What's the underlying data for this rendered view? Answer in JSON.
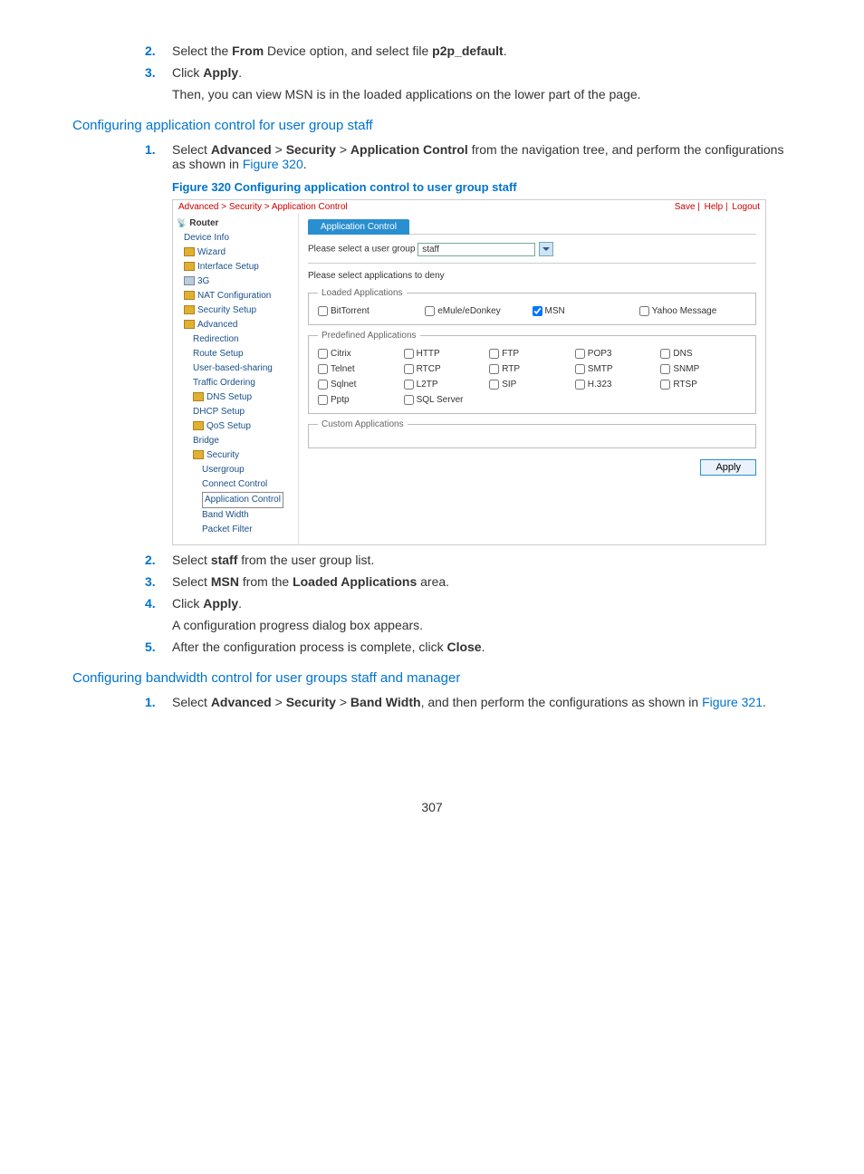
{
  "steps_top": [
    {
      "n": "2.",
      "html_parts": [
        "Select the ",
        {
          "b": "From"
        },
        " Device option, and select file ",
        {
          "b": "p2p_default"
        },
        "."
      ]
    },
    {
      "n": "3.",
      "html_parts": [
        "Click ",
        {
          "b": "Apply"
        },
        "."
      ]
    }
  ],
  "after_apply": "Then, you can view MSN is in the loaded applications on the lower part of the page.",
  "section1": "Configuring application control for user group staff",
  "s1_step1": {
    "n": "1.",
    "parts": [
      "Select ",
      {
        "b": "Advanced"
      },
      " > ",
      {
        "b": "Security"
      },
      " > ",
      {
        "b": "Application Control"
      },
      " from the navigation tree, and perform the configurations as shown in ",
      {
        "link": "Figure 320"
      },
      "."
    ]
  },
  "fig320": "Figure 320 Configuring application control to user group staff",
  "screenshot": {
    "breadcrumb": "Advanced > Security > Application Control",
    "top_links": [
      "Save",
      "Help",
      "Logout"
    ],
    "nav_root": "Router",
    "nav": [
      {
        "lv": 1,
        "label": "Device Info"
      },
      {
        "lv": 1,
        "label": "Wizard",
        "icon": true
      },
      {
        "lv": 1,
        "label": "Interface Setup",
        "icon": true
      },
      {
        "lv": 1,
        "label": "3G",
        "icon": true,
        "gray": true
      },
      {
        "lv": 1,
        "label": "NAT Configuration",
        "icon": true
      },
      {
        "lv": 1,
        "label": "Security Setup",
        "icon": true
      },
      {
        "lv": 1,
        "label": "Advanced",
        "icon": true
      },
      {
        "lv": 2,
        "label": "Redirection"
      },
      {
        "lv": 2,
        "label": "Route Setup"
      },
      {
        "lv": 2,
        "label": "User-based-sharing"
      },
      {
        "lv": 2,
        "label": "Traffic Ordering"
      },
      {
        "lv": 2,
        "label": "DNS Setup",
        "icon": true
      },
      {
        "lv": 2,
        "label": "DHCP Setup"
      },
      {
        "lv": 2,
        "label": "QoS Setup",
        "icon": true
      },
      {
        "lv": 2,
        "label": "Bridge"
      },
      {
        "lv": 2,
        "label": "Security",
        "icon": true
      },
      {
        "lv": 3,
        "label": "Usergroup"
      },
      {
        "lv": 3,
        "label": "Connect Control"
      },
      {
        "lv": 3,
        "label": "Application Control",
        "sel": true
      },
      {
        "lv": 3,
        "label": "Band Width"
      },
      {
        "lv": 3,
        "label": "Packet Filter"
      }
    ],
    "tab": "Application Control",
    "select_label": "Please select a user group",
    "select_value": "staff",
    "deny_label": "Please select applications to deny",
    "loaded_legend": "Loaded Applications",
    "loaded": [
      {
        "label": "BitTorrent",
        "checked": false
      },
      {
        "label": "eMule/eDonkey",
        "checked": false
      },
      {
        "label": "MSN",
        "checked": true
      },
      {
        "label": "Yahoo Message",
        "checked": false
      }
    ],
    "predef_legend": "Predefined Applications",
    "predef": [
      "Citrix",
      "HTTP",
      "FTP",
      "POP3",
      "DNS",
      "Telnet",
      "RTCP",
      "RTP",
      "SMTP",
      "SNMP",
      "Sqlnet",
      "L2TP",
      "SIP",
      "H.323",
      "RTSP",
      "Pptp",
      "SQL Server"
    ],
    "custom_legend": "Custom Applications",
    "apply": "Apply"
  },
  "s1_steps_after": [
    {
      "n": "2.",
      "parts": [
        "Select ",
        {
          "b": "staff"
        },
        " from the user group list."
      ]
    },
    {
      "n": "3.",
      "parts": [
        "Select ",
        {
          "b": "MSN"
        },
        " from the ",
        {
          "b": "Loaded Applications"
        },
        " area."
      ]
    },
    {
      "n": "4.",
      "parts": [
        "Click ",
        {
          "b": "Apply"
        },
        "."
      ]
    }
  ],
  "s1_after4": "A configuration progress dialog box appears.",
  "s1_step5": {
    "n": "5.",
    "parts": [
      "After the configuration process is complete, click ",
      {
        "b": "Close"
      },
      "."
    ]
  },
  "section2": "Configuring bandwidth control for user groups staff and manager",
  "s2_step1": {
    "n": "1.",
    "parts": [
      "Select ",
      {
        "b": "Advanced"
      },
      " > ",
      {
        "b": "Security"
      },
      " > ",
      {
        "b": "Band Width"
      },
      ", and then perform the configurations as shown in ",
      {
        "link": "Figure 321"
      },
      "."
    ]
  },
  "page_num": "307"
}
